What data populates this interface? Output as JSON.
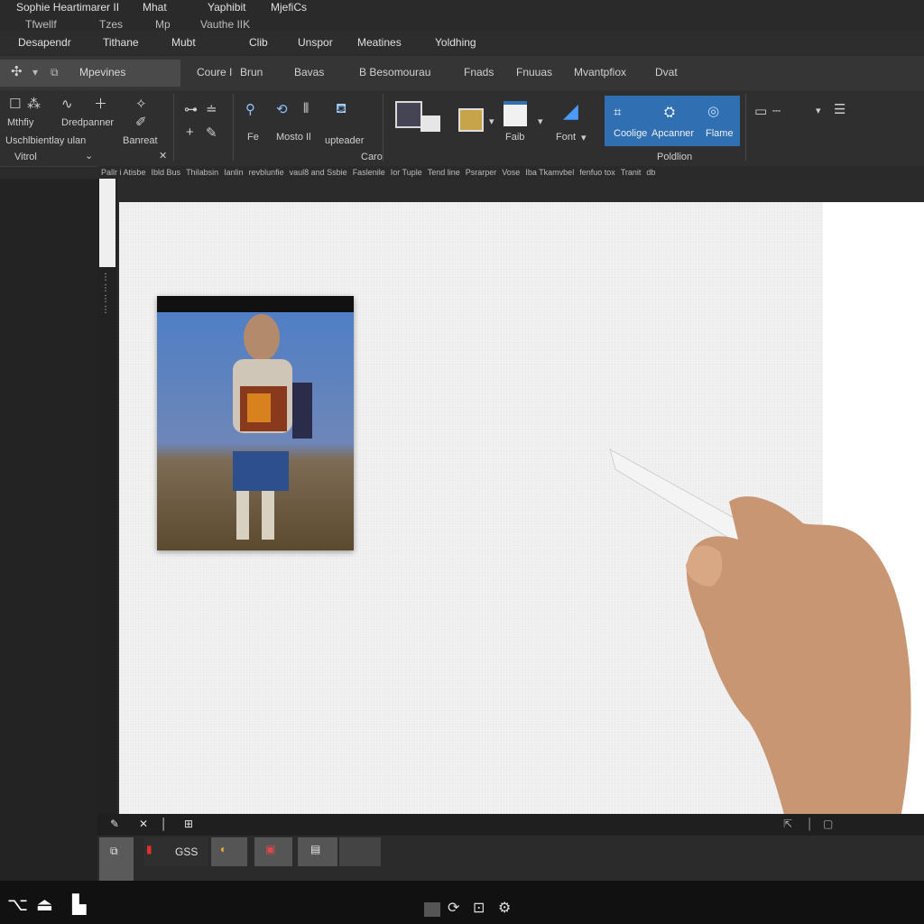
{
  "title_row": {
    "line1": [
      "Sophie Heartimarer II",
      "Mhat",
      "Yaphibit",
      "MjefiCs"
    ],
    "line2": [
      "Tfwellf",
      "Tzes",
      "Mp",
      "Vauthe IIK"
    ]
  },
  "menu": [
    "Desapendr",
    "Tithane",
    "Mubt",
    "Clib",
    "Unspor",
    "Meatines",
    "Yoldhing"
  ],
  "tabs": {
    "active": "Mpevines",
    "items": [
      "Coure I",
      "Brun",
      "Bavas",
      "B Besomourau",
      "Fnads",
      "Fnuuas",
      "Mvantpfiox",
      "Dvat"
    ]
  },
  "ribbon": {
    "left_group": {
      "labels": [
        "Mthfiy",
        "Dredpanner",
        "Uschlbientlay ulan",
        "Banreat",
        "Vitrol"
      ]
    },
    "center_group": {
      "labels": [
        "Fe",
        "Mosto Il",
        "upteader"
      ],
      "group_label": "Caro"
    },
    "insert_group": {
      "labels": [
        "Faib",
        "Font"
      ]
    },
    "highlight_group": {
      "labels": [
        "Coolige",
        "Apcanner",
        "Flame"
      ],
      "group_label": "Poldlion"
    }
  },
  "ruler_labels": [
    "Pallr i Atisbe",
    "Ibld Bus",
    "Thilabsin",
    "Ianlin",
    "revblunfie",
    "vaul8 and Ssbie",
    "Faslenile",
    "Ior Tuple",
    "Tend line",
    "Psrarper",
    "Vose",
    "Iba Tkamvbel",
    "fenfuo tox",
    "Tranit",
    "db"
  ],
  "status": {
    "left_icons": [
      "pen-icon",
      "cursor-icon",
      "bar-icon",
      "grid-icon"
    ]
  },
  "thumbnails": [
    {
      "label": ""
    },
    {
      "label": "GSS"
    },
    {
      "label": ""
    },
    {
      "label": ""
    },
    {
      "label": ""
    }
  ],
  "colors": {
    "accent": "#2f6fb2",
    "background": "#2b2b2b",
    "canvas": "#f2f2f2"
  }
}
